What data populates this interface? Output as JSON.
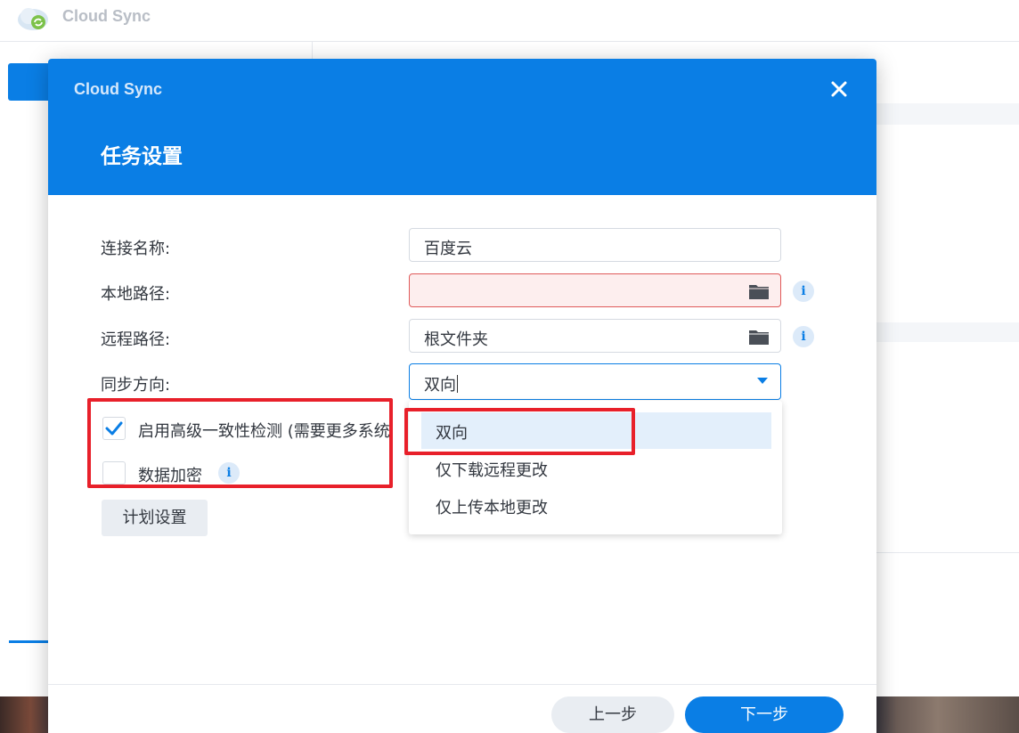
{
  "app": {
    "title": "Cloud Sync",
    "logo_icon": "cloud-sync-icon"
  },
  "dialog": {
    "app_title": "Cloud Sync",
    "step_title": "任务设置",
    "close_icon": "close-icon"
  },
  "form": {
    "connection_name": {
      "label": "连接名称:",
      "value": "百度云"
    },
    "local_path": {
      "label": "本地路径:",
      "value": "",
      "state": "error"
    },
    "remote_path": {
      "label": "远程路径:",
      "value": "根文件夹"
    },
    "sync_direction": {
      "label": "同步方向:",
      "value": "双向"
    }
  },
  "options": {
    "consistency_check": {
      "label": "启用高级一致性检测 (需要更多系统",
      "checked": true
    },
    "data_encryption": {
      "label": "数据加密",
      "checked": false
    }
  },
  "buttons": {
    "schedule": "计划设置",
    "prev": "上一步",
    "next": "下一步"
  },
  "dropdown": {
    "options": [
      "双向",
      "仅下载远程更改",
      "仅上传本地更改"
    ],
    "selected": "双向"
  },
  "colors": {
    "accent": "#0a7ee5",
    "error_bg": "#fdeeee",
    "annotation": "#e8202a"
  }
}
